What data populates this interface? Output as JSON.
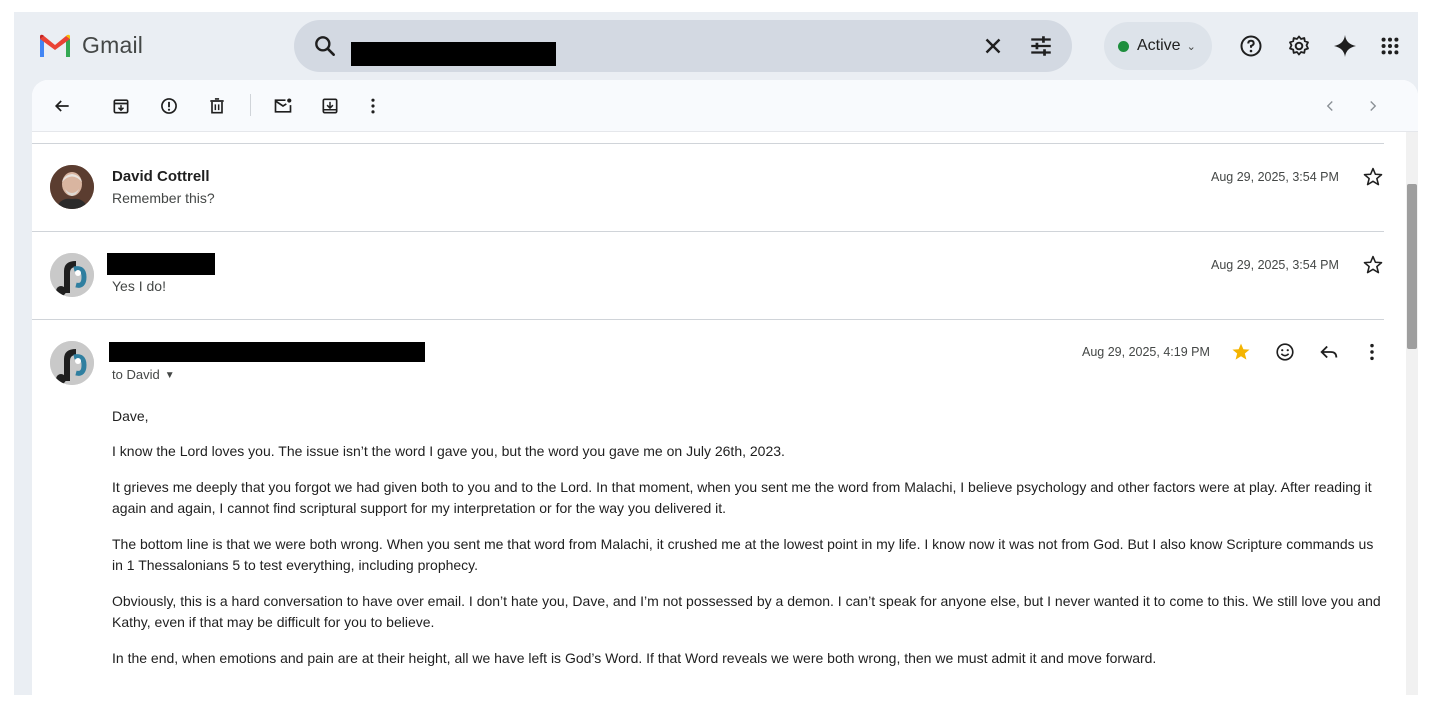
{
  "app": {
    "name": "Gmail"
  },
  "search": {
    "query": ""
  },
  "status": {
    "label": "Active",
    "color": "#1e8e3e"
  },
  "toolbar": {
    "back": "back",
    "archive": "archive",
    "report_spam": "report spam",
    "delete": "delete",
    "mark_unread": "mark as unread",
    "move_to": "move to",
    "more": "more"
  },
  "messages": [
    {
      "sender": "David Cottrell",
      "snippet": "Remember this?",
      "date": "Aug 29, 2025, 3:54 PM",
      "starred": false
    },
    {
      "sender": "",
      "snippet": "Yes I do!",
      "date": "Aug 29, 2025, 3:54 PM",
      "starred": false
    },
    {
      "sender": "",
      "to": "to David",
      "date": "Aug 29, 2025, 4:19 PM",
      "starred": true,
      "body": {
        "greeting": "Dave,",
        "p1": "I know the Lord loves you. The issue isn’t the word I gave you, but the word you gave me on July 26th, 2023.",
        "p2": "It grieves me deeply that you forgot we had given both to you and to the Lord. In that moment, when you sent me the word from Malachi, I believe psychology and other factors were at play. After reading it again and again, I cannot find scriptural support for my interpretation or for the way you delivered it.",
        "p3": "The bottom line is that we were both wrong. When you sent me that word from Malachi, it crushed me at the lowest point in my life. I know now it was not from God. But I also know Scripture commands us in 1 Thessalonians 5 to test everything, including prophecy.",
        "p4": "Obviously, this is a hard conversation to have over email. I don’t hate you, Dave, and I’m not possessed by a demon. I can’t speak for anyone else, but I never wanted it to come to this. We still love you and Kathy, even if that may be difficult for you to believe.",
        "p5": "In the end, when emotions and pain are at their height, all we have left is God’s Word. If that Word reveals we were both wrong, then we must admit it and move forward."
      }
    }
  ],
  "colors": {
    "star": "#f4b400",
    "accent": "#0b57d0"
  }
}
